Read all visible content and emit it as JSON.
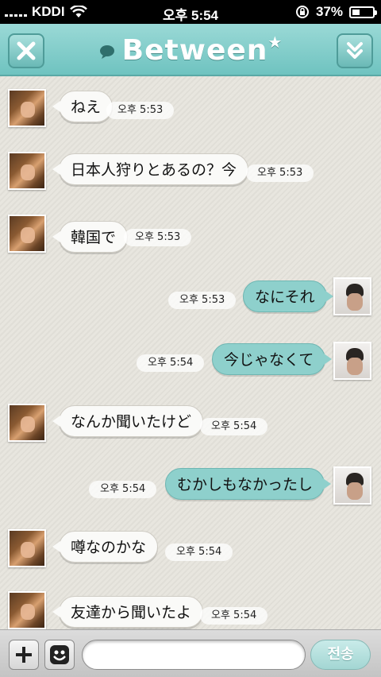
{
  "status_bar": {
    "carrier": "KDDI",
    "time": "오후 5:54",
    "battery": "37%",
    "battery_level": 0.37
  },
  "header": {
    "title": "Between",
    "title_star": "★",
    "close_icon": "close-icon",
    "collapse_icon": "double-chevron-down-icon"
  },
  "messages": [
    {
      "side": "in",
      "text": "ねえ",
      "time": "오후 5:53"
    },
    {
      "side": "in",
      "text": "日本人狩りとあるの？今",
      "time": "오후 5:53"
    },
    {
      "side": "in",
      "text": "韓国で",
      "time": "오후 5:53"
    },
    {
      "side": "out",
      "text": "なにそれ",
      "time": "오후 5:53"
    },
    {
      "side": "out",
      "text": "今じゃなくて",
      "time": "오후 5:54"
    },
    {
      "side": "in",
      "text": "なんか聞いたけど",
      "time": "오후 5:54"
    },
    {
      "side": "out",
      "text": "むかしもなかったし",
      "time": "오후 5:54"
    },
    {
      "side": "in",
      "text": "噂なのかな",
      "time": "오후 5:54"
    },
    {
      "side": "in",
      "text": "友達から聞いたよ",
      "time": "오후 5:54"
    }
  ],
  "input": {
    "value": "",
    "placeholder": "",
    "send_label": "전송"
  },
  "colors": {
    "accent": "#7fcbc8",
    "outgoing_bubble": "#8ed0cc",
    "incoming_bubble": "#fafaf8"
  }
}
